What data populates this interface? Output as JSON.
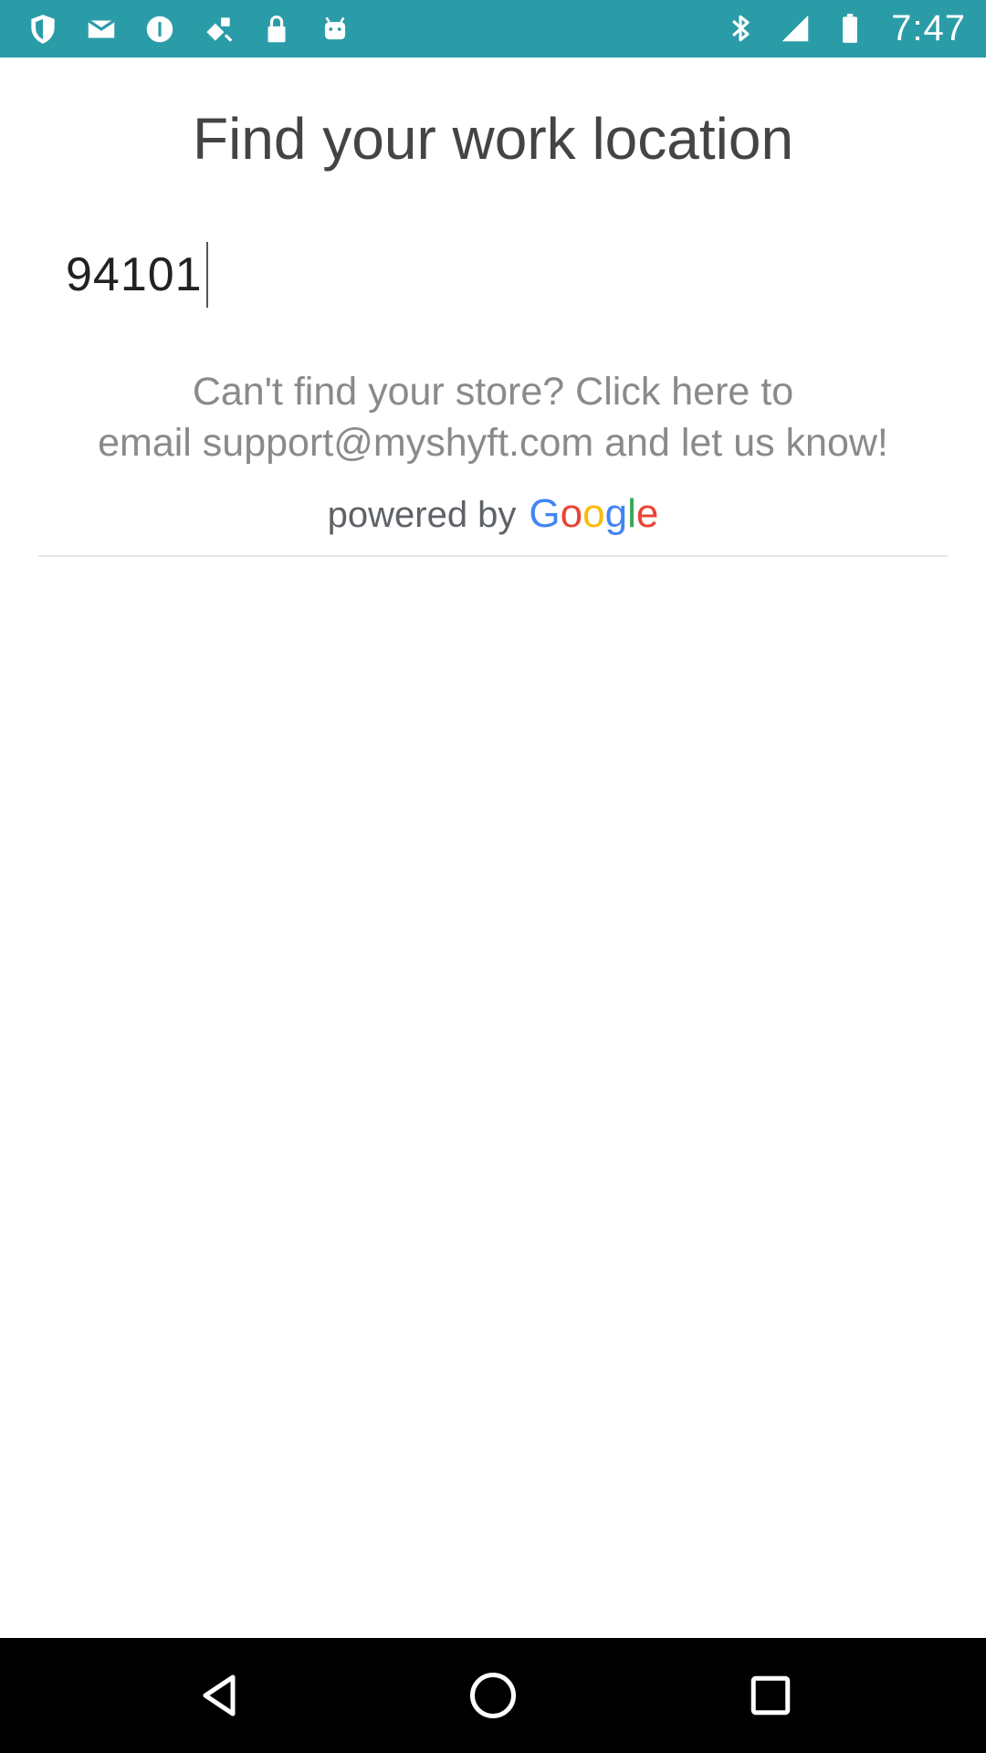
{
  "status_bar": {
    "time": "7:47",
    "left_icons": [
      "shield-icon",
      "gmail-icon",
      "info-icon",
      "fake-gps-icon",
      "lock-icon",
      "android-icon"
    ],
    "right_icons": [
      "bluetooth-icon",
      "signal-icon",
      "battery-icon"
    ],
    "background": "#2a9ca8"
  },
  "page": {
    "title": "Find your work location",
    "search_value": "94101",
    "help_line1": "Can't find your store? Click here to",
    "help_line2": "email support@myshyft.com and let us know!",
    "powered_by_label": "powered by",
    "google_letters": [
      {
        "char": "G",
        "color": "#4285F4"
      },
      {
        "char": "o",
        "color": "#EA4335"
      },
      {
        "char": "o",
        "color": "#FBBC05"
      },
      {
        "char": "g",
        "color": "#4285F4"
      },
      {
        "char": "l",
        "color": "#34A853"
      },
      {
        "char": "e",
        "color": "#EA4335"
      }
    ]
  },
  "nav_bar": {
    "buttons": [
      "back-icon",
      "home-icon",
      "recents-icon"
    ]
  }
}
